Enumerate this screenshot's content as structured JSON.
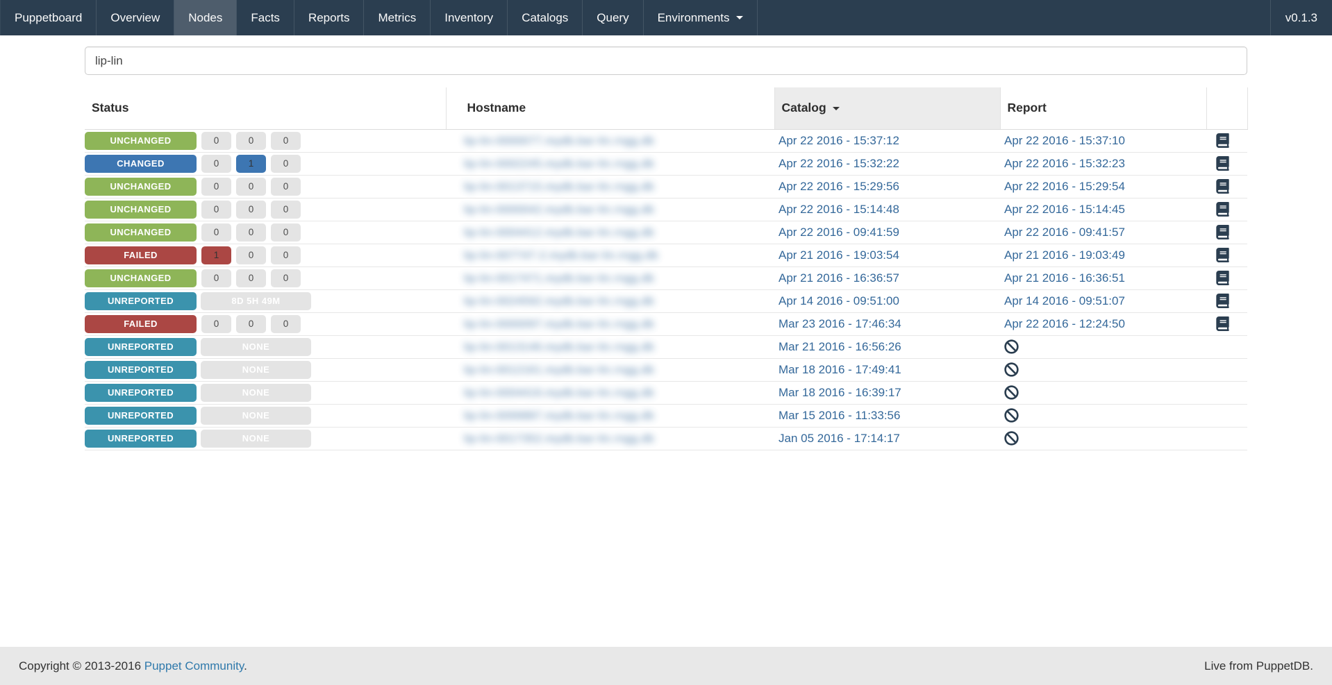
{
  "navbar": {
    "items": [
      {
        "label": "Puppetboard",
        "active": false,
        "dropdown": false
      },
      {
        "label": "Overview",
        "active": false,
        "dropdown": false
      },
      {
        "label": "Nodes",
        "active": true,
        "dropdown": false
      },
      {
        "label": "Facts",
        "active": false,
        "dropdown": false
      },
      {
        "label": "Reports",
        "active": false,
        "dropdown": false
      },
      {
        "label": "Metrics",
        "active": false,
        "dropdown": false
      },
      {
        "label": "Inventory",
        "active": false,
        "dropdown": false
      },
      {
        "label": "Catalogs",
        "active": false,
        "dropdown": false
      },
      {
        "label": "Query",
        "active": false,
        "dropdown": false
      },
      {
        "label": "Environments",
        "active": false,
        "dropdown": true
      }
    ],
    "version_label": "v0.1.3"
  },
  "search": {
    "value": "lip-lin",
    "placeholder": ""
  },
  "table": {
    "headers": {
      "status": "Status",
      "hostname": "Hostname",
      "catalog": "Catalog",
      "report": "Report"
    },
    "sort": {
      "column": "Catalog",
      "direction": "desc"
    },
    "rows": [
      {
        "status": "UNCHANGED",
        "counts": [
          {
            "v": "0"
          },
          {
            "v": "0"
          },
          {
            "v": "0"
          }
        ],
        "hostname_redacted": "lip-lin-0000077.mydb.bar-lin.rngg.db",
        "catalog": "Apr 22 2016 - 15:37:12",
        "report": "Apr 22 2016 - 15:37:10",
        "icon": "book"
      },
      {
        "status": "CHANGED",
        "counts": [
          {
            "v": "0"
          },
          {
            "v": "1",
            "hl": "changed"
          },
          {
            "v": "0"
          }
        ],
        "hostname_redacted": "lip-lin-0002245.mydb.bar-lin.rngg.db",
        "catalog": "Apr 22 2016 - 15:32:22",
        "report": "Apr 22 2016 - 15:32:23",
        "icon": "book"
      },
      {
        "status": "UNCHANGED",
        "counts": [
          {
            "v": "0"
          },
          {
            "v": "0"
          },
          {
            "v": "0"
          }
        ],
        "hostname_redacted": "lip-lin-0013715.mydb.bar-lin.rngg.db",
        "catalog": "Apr 22 2016 - 15:29:56",
        "report": "Apr 22 2016 - 15:29:54",
        "icon": "book"
      },
      {
        "status": "UNCHANGED",
        "counts": [
          {
            "v": "0"
          },
          {
            "v": "0"
          },
          {
            "v": "0"
          }
        ],
        "hostname_redacted": "lip-lin-0000042.mydb.bar-lin.rngg.db",
        "catalog": "Apr 22 2016 - 15:14:48",
        "report": "Apr 22 2016 - 15:14:45",
        "icon": "book"
      },
      {
        "status": "UNCHANGED",
        "counts": [
          {
            "v": "0"
          },
          {
            "v": "0"
          },
          {
            "v": "0"
          }
        ],
        "hostname_redacted": "lip-lin-0004412.mydb.bar-lin.rngg.db",
        "catalog": "Apr 22 2016 - 09:41:59",
        "report": "Apr 22 2016 - 09:41:57",
        "icon": "book"
      },
      {
        "status": "FAILED",
        "counts": [
          {
            "v": "1",
            "hl": "failed"
          },
          {
            "v": "0"
          },
          {
            "v": "0"
          }
        ],
        "hostname_redacted": "lip-lin-007747-2.mydb.bar-lin.rngg.db",
        "catalog": "Apr 21 2016 - 19:03:54",
        "report": "Apr 21 2016 - 19:03:49",
        "icon": "book"
      },
      {
        "status": "UNCHANGED",
        "counts": [
          {
            "v": "0"
          },
          {
            "v": "0"
          },
          {
            "v": "0"
          }
        ],
        "hostname_redacted": "lip-lin-0017471.mydb.bar-lin.rngg.db",
        "catalog": "Apr 21 2016 - 16:36:57",
        "report": "Apr 21 2016 - 16:36:51",
        "icon": "book"
      },
      {
        "status": "UNREPORTED",
        "wide_pill": "8D 5H 49M",
        "hostname_redacted": "lip-lin-0024592.mydb.bar-lin.rngg.db",
        "catalog": "Apr 14 2016 - 09:51:00",
        "report": "Apr 14 2016 - 09:51:07",
        "icon": "book"
      },
      {
        "status": "FAILED",
        "counts": [
          {
            "v": "0"
          },
          {
            "v": "0"
          },
          {
            "v": "0"
          }
        ],
        "hostname_redacted": "lip-lin-0000097.mydb.bar-lin.rngg.db",
        "catalog": "Mar 23 2016 - 17:46:34",
        "report": "Apr 22 2016 - 12:24:50",
        "icon": "book"
      },
      {
        "status": "UNREPORTED",
        "wide_pill": "NONE",
        "hostname_redacted": "lip-lin-0013146.mydb.bar-lin.rngg.db",
        "catalog": "Mar 21 2016 - 16:56:26",
        "report": null,
        "icon": "ban"
      },
      {
        "status": "UNREPORTED",
        "wide_pill": "NONE",
        "hostname_redacted": "lip-lin-0012161.mydb.bar-lin.rngg.db",
        "catalog": "Mar 18 2016 - 17:49:41",
        "report": null,
        "icon": "ban"
      },
      {
        "status": "UNREPORTED",
        "wide_pill": "NONE",
        "hostname_redacted": "lip-lin-0004416.mydb.bar-lin.rngg.db",
        "catalog": "Mar 18 2016 - 16:39:17",
        "report": null,
        "icon": "ban"
      },
      {
        "status": "UNREPORTED",
        "wide_pill": "NONE",
        "hostname_redacted": "lip-lin-0099887.mydb.bar-lin.rngg.db",
        "catalog": "Mar 15 2016 - 11:33:56",
        "report": null,
        "icon": "ban"
      },
      {
        "status": "UNREPORTED",
        "wide_pill": "NONE",
        "hostname_redacted": "lip-lin-0017352.mydb.bar-lin.rngg.db",
        "catalog": "Jan 05 2016 - 17:14:17",
        "report": null,
        "icon": "ban"
      }
    ]
  },
  "footer": {
    "copyright_prefix": "Copyright © 2013-2016 ",
    "community_link": "Puppet Community",
    "period": ".",
    "live_text": "Live from PuppetDB."
  },
  "colors": {
    "navbar_bg": "#2b3e50",
    "navbar_active_bg": "#4e5d6c",
    "unchanged": "#8eb558",
    "changed": "#3d76b2",
    "failed": "#ab4744",
    "unreported": "#3b93ad",
    "pill_bg": "#e4e4e4",
    "link": "#34689a",
    "icon": "#2b3e50",
    "footer_bg": "#e8e8e8",
    "sorted_header_bg": "#ececec"
  }
}
